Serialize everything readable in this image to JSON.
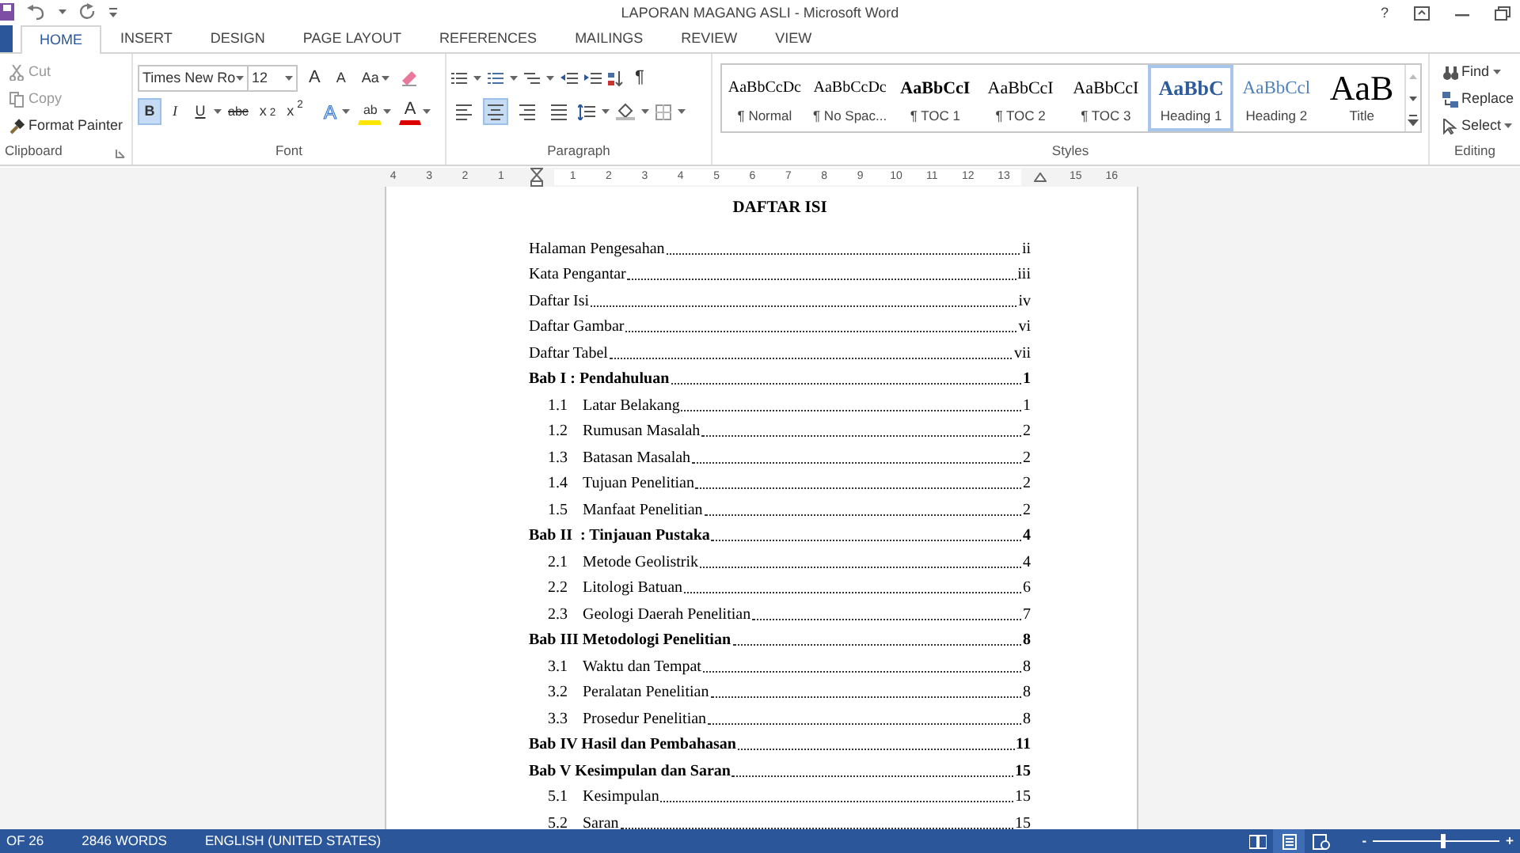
{
  "window": {
    "title": "LAPORAN MAGANG ASLI - Microsoft Word",
    "help": "?"
  },
  "tabs": [
    {
      "label": "HOME",
      "selected": true
    },
    {
      "label": "INSERT",
      "selected": false
    },
    {
      "label": "DESIGN",
      "selected": false
    },
    {
      "label": "PAGE LAYOUT",
      "selected": false
    },
    {
      "label": "REFERENCES",
      "selected": false
    },
    {
      "label": "MAILINGS",
      "selected": false
    },
    {
      "label": "REVIEW",
      "selected": false
    },
    {
      "label": "VIEW",
      "selected": false
    }
  ],
  "clipboard": {
    "label": "Clipboard",
    "items": [
      {
        "kind": "cut",
        "label": "Cut",
        "disabled": true
      },
      {
        "kind": "copy",
        "label": "Copy",
        "disabled": true
      },
      {
        "kind": "painter",
        "label": "Format Painter",
        "disabled": false
      }
    ]
  },
  "font": {
    "label": "Font",
    "font_name": "Times New Ro",
    "font_size": "12",
    "case_label": "Aa",
    "grow": "A",
    "shrink": "A",
    "formats": [
      {
        "kind": "bold",
        "label": "B",
        "selected": true
      },
      {
        "kind": "italic",
        "label": "I",
        "selected": false
      },
      {
        "kind": "underline",
        "label": "U",
        "selected": false
      },
      {
        "kind": "strike",
        "label": "abc",
        "selected": false
      },
      {
        "kind": "sub",
        "label": "x$_{2}$",
        "selected": false
      },
      {
        "kind": "sup",
        "label": "x$^{2}$",
        "selected": false
      }
    ],
    "effects": "A",
    "highlight": "ab",
    "color_label": "A"
  },
  "paragraph": {
    "label": "Paragraph",
    "pilcrow": "¶",
    "align": [
      {
        "kind": "left",
        "selected": false
      },
      {
        "kind": "center",
        "selected": true
      },
      {
        "kind": "right",
        "selected": false
      },
      {
        "kind": "justify",
        "selected": false
      }
    ]
  },
  "styles": {
    "label": "Styles",
    "items": [
      {
        "kind": "normal",
        "preview": "AaBbCcDc",
        "name": "¶ Normal",
        "selected": false
      },
      {
        "kind": "normal",
        "preview": "AaBbCcDc",
        "name": "¶ No Spac...",
        "selected": false
      },
      {
        "kind": "toc1",
        "preview": "AaBbCcI",
        "name": "¶ TOC 1",
        "selected": false
      },
      {
        "kind": "toc",
        "preview": "AaBbCcI",
        "name": "¶ TOC 2",
        "selected": false
      },
      {
        "kind": "toc",
        "preview": "AaBbCcI",
        "name": "¶ TOC 3",
        "selected": false
      },
      {
        "kind": "heading1",
        "preview": "AaBbC",
        "name": "Heading 1",
        "selected": true
      },
      {
        "kind": "heading2",
        "preview": "AaBbCcl",
        "name": "Heading 2",
        "selected": false
      },
      {
        "kind": "title",
        "preview": "AaB",
        "name": "Title",
        "selected": false
      }
    ]
  },
  "editing": {
    "label": "Editing",
    "items": [
      {
        "kind": "find",
        "label": "Find",
        "dropdown": true
      },
      {
        "kind": "replace",
        "label": "Replace",
        "dropdown": false
      },
      {
        "kind": "select",
        "label": "Select",
        "dropdown": true
      }
    ]
  },
  "ruler": [
    {
      "kind": "number",
      "label": "4"
    },
    {
      "kind": "number",
      "label": "3"
    },
    {
      "kind": "number",
      "label": "2"
    },
    {
      "kind": "number",
      "label": "1"
    },
    {
      "kind": "left-indent"
    },
    {
      "kind": "number",
      "label": "1"
    },
    {
      "kind": "number",
      "label": "2"
    },
    {
      "kind": "number",
      "label": "3"
    },
    {
      "kind": "number",
      "label": "4"
    },
    {
      "kind": "number",
      "label": "5"
    },
    {
      "kind": "number",
      "label": "6"
    },
    {
      "kind": "number",
      "label": "7"
    },
    {
      "kind": "number",
      "label": "8"
    },
    {
      "kind": "number",
      "label": "9"
    },
    {
      "kind": "number",
      "label": "10"
    },
    {
      "kind": "number",
      "label": "11"
    },
    {
      "kind": "number",
      "label": "12"
    },
    {
      "kind": "number",
      "label": "13"
    },
    {
      "kind": "right-indent"
    },
    {
      "kind": "number",
      "label": "15"
    },
    {
      "kind": "number",
      "label": "16"
    }
  ],
  "document": {
    "heading": "DAFTAR ISI",
    "toc": [
      {
        "kind": "front",
        "label": "Halaman Pengesahan",
        "page": "ii"
      },
      {
        "kind": "front",
        "label": "Kata Pengantar",
        "page": "iii"
      },
      {
        "kind": "front",
        "label": "Daftar Isi",
        "page": "iv"
      },
      {
        "kind": "front",
        "label": "Daftar Gambar",
        "page": "vi"
      },
      {
        "kind": "front",
        "label": "Daftar Tabel",
        "page": "vii"
      },
      {
        "kind": "chapter",
        "label": "Bab I : Pendahuluan",
        "page": "1"
      },
      {
        "kind": "section",
        "number": "1.1",
        "label": "Latar Belakang",
        "page": "1"
      },
      {
        "kind": "section",
        "number": "1.2",
        "label": "Rumusan Masalah",
        "page": "2"
      },
      {
        "kind": "section",
        "number": "1.3",
        "label": "Batasan Masalah",
        "page": "2"
      },
      {
        "kind": "section",
        "number": "1.4",
        "label": "Tujuan Penelitian",
        "page": "2"
      },
      {
        "kind": "section",
        "number": "1.5",
        "label": "Manfaat Penelitian",
        "page": "2"
      },
      {
        "kind": "chapter",
        "label": "Bab II  : Tinjauan Pustaka",
        "page": "4"
      },
      {
        "kind": "section",
        "number": "2.1",
        "label": "Metode Geolistrik",
        "page": "4"
      },
      {
        "kind": "section",
        "number": "2.2",
        "label": "Litologi Batuan",
        "page": "6"
      },
      {
        "kind": "section",
        "number": "2.3",
        "label": "Geologi Daerah Penelitian",
        "page": "7"
      },
      {
        "kind": "chapter",
        "label": "Bab III Metodologi Penelitian",
        "page": "8"
      },
      {
        "kind": "section",
        "number": "3.1",
        "label": "Waktu dan Tempat",
        "page": "8"
      },
      {
        "kind": "section",
        "number": "3.2",
        "label": "Peralatan Penelitian",
        "page": "8"
      },
      {
        "kind": "section",
        "number": "3.3",
        "label": "Prosedur Penelitian",
        "page": "8"
      },
      {
        "kind": "chapter",
        "label": "Bab IV Hasil dan Pembahasan",
        "page": "11"
      },
      {
        "kind": "chapter",
        "label": "Bab V Kesimpulan dan Saran",
        "page": "15"
      },
      {
        "kind": "section",
        "number": "5.1",
        "label": "Kesimpulan",
        "page": "15"
      },
      {
        "kind": "section",
        "number": "5.2",
        "label": "Saran",
        "page": "15"
      }
    ]
  },
  "status_bar": {
    "page": "OF 26",
    "words": "2846 WORDS",
    "language": "ENGLISH (UNITED STATES)",
    "views": [
      {
        "kind": "read",
        "selected": false
      },
      {
        "kind": "print",
        "selected": true
      },
      {
        "kind": "web",
        "selected": false
      }
    ],
    "zoom_out": "-",
    "zoom_in": "+",
    "zoom": {
      "level": 0.55
    }
  }
}
